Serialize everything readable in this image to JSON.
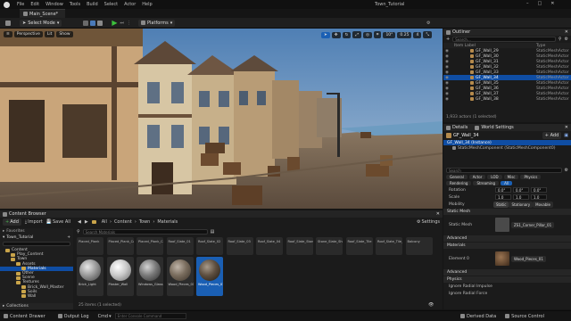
{
  "window": {
    "title": "Town_Tutorial",
    "menu": [
      "File",
      "Edit",
      "Window",
      "Tools",
      "Build",
      "Select",
      "Actor",
      "Help"
    ]
  },
  "tabs": {
    "active": "Main_Scene*"
  },
  "toolbar": {
    "select_mode": "Select Mode",
    "platforms": "Platforms"
  },
  "viewport": {
    "perspective": "Perspective",
    "lit": "Lit",
    "show": "Show",
    "fov": "10°",
    "scale": "0.25",
    "cam_speed": "4"
  },
  "outliner": {
    "title": "Outliner",
    "search_placeholder": "Search...",
    "col_label": "Item Label",
    "col_type": "Type",
    "rows": [
      {
        "name": "GF_Wall_29",
        "type": "StaticMeshActor",
        "sel": false
      },
      {
        "name": "GF_Wall_30",
        "type": "StaticMeshActor",
        "sel": false
      },
      {
        "name": "GF_Wall_31",
        "type": "StaticMeshActor",
        "sel": false
      },
      {
        "name": "GF_Wall_32",
        "type": "StaticMeshActor",
        "sel": false
      },
      {
        "name": "GF_Wall_33",
        "type": "StaticMeshActor",
        "sel": false
      },
      {
        "name": "GF_Wall_34",
        "type": "StaticMeshActor",
        "sel": true
      },
      {
        "name": "GF_Wall_35",
        "type": "StaticMeshActor",
        "sel": false
      },
      {
        "name": "GF_Wall_36",
        "type": "StaticMeshActor",
        "sel": false
      },
      {
        "name": "GF_Wall_37",
        "type": "StaticMeshActor",
        "sel": false
      },
      {
        "name": "GF_Wall_38",
        "type": "StaticMeshActor",
        "sel": false
      }
    ],
    "count": "1,933 actors (1 selected)"
  },
  "details": {
    "tab": "Details",
    "tab2": "World Settings",
    "actor": "GF_Wall_34",
    "add": "+ Add",
    "instance": "GF_Wall_34 (Instance)",
    "component": "StaticMeshComponent (StaticMeshComponent0)",
    "search_placeholder": "Search",
    "filters": [
      "General",
      "Actor",
      "LOD",
      "Misc",
      "Physics",
      "Rendering",
      "Streaming",
      "All"
    ],
    "transform": {
      "rotation": {
        "label": "Rotation",
        "x": "0.0°",
        "y": "0.0°",
        "z": "0.0°"
      },
      "scale": {
        "label": "Scale",
        "x": "1.0",
        "y": "1.0",
        "z": "1.0"
      },
      "mobility": {
        "label": "Mobility",
        "options": [
          "Static",
          "Stationary",
          "Movable"
        ]
      }
    },
    "static_mesh_section": "Static Mesh",
    "static_mesh_label": "Static Mesh",
    "static_mesh_value": "ZS1_Corner_Pillar_01",
    "advanced": "Advanced",
    "materials_section": "Materials",
    "element_label": "Element 0",
    "material_value": "Wood_Pieces_01",
    "physics_section": "Physics",
    "physics_row1": "Ignore Radial Impulse",
    "physics_row2": "Ignore Radial Force"
  },
  "content_browser": {
    "tab": "Content Browser",
    "add": "Add",
    "import": "Import",
    "save_all": "Save All",
    "settings": "Settings",
    "breadcrumb": [
      "All",
      "Content",
      "Town",
      "Materials"
    ],
    "search_placeholder": "Search Materials",
    "favorites": "Favorites",
    "project": "Town_Tutorial",
    "tree": [
      "Content",
      "Play_Content",
      "Town",
      "Assets",
      "Materials",
      "Other",
      "Scene",
      "Textures",
      "Brick_Wall_Master",
      "Soils",
      "Wall"
    ],
    "items_top": [
      "Placed_Plank",
      "Placed_Plank_Cap",
      "Placed_Plank_Cap2",
      "Roof_Slate_01",
      "Roof_Slate_02",
      "Roof_Slate_03",
      "Roof_Slate_04",
      "Roof_Slate_Stone",
      "Stone_Slate_Sheet",
      "Roof_Slate_Tile",
      "Roof_Slate_Tile_Black",
      "Balcony"
    ],
    "materials": [
      "Brick_Light",
      "Plaster_Wall",
      "Windows_Glass",
      "Wood_Pieces_01",
      "Wood_Pieces_01_Black"
    ],
    "count": "25 items (1 selected)",
    "collections": "Collections"
  },
  "statusbar": {
    "content_drawer": "Content Drawer",
    "output_log": "Output Log",
    "cmd": "Cmd",
    "console_placeholder": "Enter Console Command",
    "derived_data": "Derived Data",
    "source_control": "Source Control"
  }
}
